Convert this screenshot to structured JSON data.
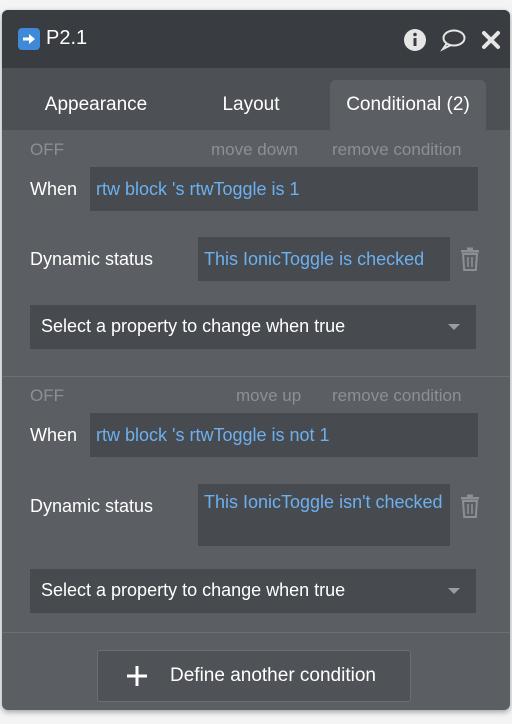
{
  "panel": {
    "title": "P2.1",
    "accent_color": "#3f89d8",
    "titlebar_icons": [
      "info-icon",
      "comment-icon",
      "close-icon"
    ]
  },
  "tabs": [
    {
      "label": "Appearance",
      "active": false
    },
    {
      "label": "Layout",
      "active": false
    },
    {
      "label": "Conditional (2)",
      "active": true
    }
  ],
  "conditions": [
    {
      "state": "OFF",
      "move_label": "move down",
      "remove_label": "remove condition",
      "when_label": "When",
      "when_expression": "rtw block 's rtwToggle is 1",
      "status_label": "Dynamic status",
      "status_expression": "This IonicToggle is checked",
      "property_placeholder": "Select a property to change when true"
    },
    {
      "state": "OFF",
      "move_label": "move up",
      "remove_label": "remove condition",
      "when_label": "When",
      "when_expression": "rtw block 's rtwToggle is not 1",
      "status_label": "Dynamic status",
      "status_expression": "This IonicToggle isn't checked",
      "property_placeholder": "Select a property to change when true"
    }
  ],
  "add_condition_label": "Define another condition",
  "expression_color": "#6cb0f0"
}
